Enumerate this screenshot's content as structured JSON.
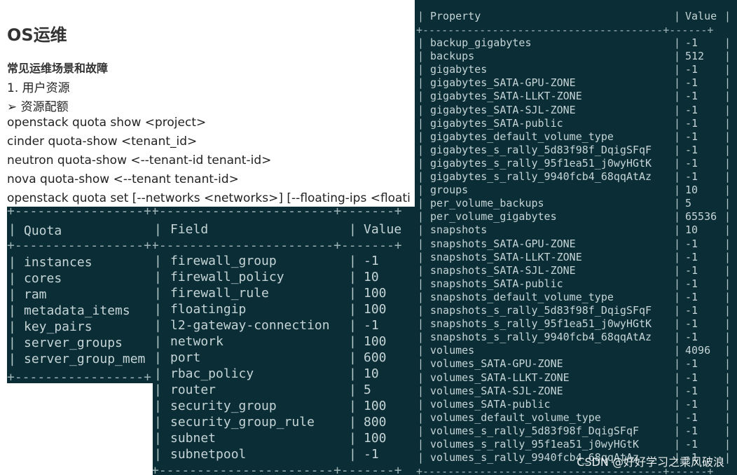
{
  "doc": {
    "title": "OS运维",
    "subtitle": "常见运维场景和故障",
    "lines": [
      "1.    用户资源",
      "➢   资源配额",
      "openstack quota show <project>",
      "cinder quota-show <tenant_id>",
      "neutron quota-show <--tenant-id tenant-id>",
      "nova quota-show <--tenant tenant-id>",
      "openstack quota set [--networks <networks>] [--floating-ips <floati"
    ]
  },
  "nova_table": {
    "header": "Quota",
    "rows": [
      "instances",
      "cores",
      "ram",
      "metadata_items",
      "key_pairs",
      "server_groups",
      "server_group_mem"
    ]
  },
  "neutron_table": {
    "header_field": "Field",
    "header_value": "Value",
    "rows": [
      {
        "field": "firewall_group",
        "value": "-1"
      },
      {
        "field": "firewall_policy",
        "value": "10"
      },
      {
        "field": "firewall_rule",
        "value": "100"
      },
      {
        "field": "floatingip",
        "value": "100"
      },
      {
        "field": "l2-gateway-connection",
        "value": "-1"
      },
      {
        "field": "network",
        "value": "100"
      },
      {
        "field": "port",
        "value": "600"
      },
      {
        "field": "rbac_policy",
        "value": "10"
      },
      {
        "field": "router",
        "value": "5"
      },
      {
        "field": "security_group",
        "value": "100"
      },
      {
        "field": "security_group_rule",
        "value": "800"
      },
      {
        "field": "subnet",
        "value": "100"
      },
      {
        "field": "subnetpool",
        "value": "-1"
      }
    ]
  },
  "cinder_table": {
    "header_property": "Property",
    "header_value": "Value",
    "rows": [
      {
        "property": "backup_gigabytes",
        "value": "-1"
      },
      {
        "property": "backups",
        "value": "512"
      },
      {
        "property": "gigabytes",
        "value": "-1"
      },
      {
        "property": "gigabytes_SATA-GPU-ZONE",
        "value": "-1"
      },
      {
        "property": "gigabytes_SATA-LLKT-ZONE",
        "value": "-1"
      },
      {
        "property": "gigabytes_SATA-SJL-ZONE",
        "value": "-1"
      },
      {
        "property": "gigabytes_SATA-public",
        "value": "-1"
      },
      {
        "property": "gigabytes_default_volume_type",
        "value": "-1"
      },
      {
        "property": "gigabytes_s_rally_5d83f98f_DqigSFqF",
        "value": "-1"
      },
      {
        "property": "gigabytes_s_rally_95f1ea51_j0wyHGtK",
        "value": "-1"
      },
      {
        "property": "gigabytes_s_rally_9940fcb4_68qqAtAz",
        "value": "-1"
      },
      {
        "property": "groups",
        "value": "10"
      },
      {
        "property": "per_volume_backups",
        "value": "5"
      },
      {
        "property": "per_volume_gigabytes",
        "value": "65536"
      },
      {
        "property": "snapshots",
        "value": "10"
      },
      {
        "property": "snapshots_SATA-GPU-ZONE",
        "value": "-1"
      },
      {
        "property": "snapshots_SATA-LLKT-ZONE",
        "value": "-1"
      },
      {
        "property": "snapshots_SATA-SJL-ZONE",
        "value": "-1"
      },
      {
        "property": "snapshots_SATA-public",
        "value": "-1"
      },
      {
        "property": "snapshots_default_volume_type",
        "value": "-1"
      },
      {
        "property": "snapshots_s_rally_5d83f98f_DqigSFqF",
        "value": "-1"
      },
      {
        "property": "snapshots_s_rally_95f1ea51_j0wyHGtK",
        "value": "-1"
      },
      {
        "property": "snapshots_s_rally_9940fcb4_68qqAtAz",
        "value": "-1"
      },
      {
        "property": "volumes",
        "value": "4096"
      },
      {
        "property": "volumes_SATA-GPU-ZONE",
        "value": "-1"
      },
      {
        "property": "volumes_SATA-LLKT-ZONE",
        "value": "-1"
      },
      {
        "property": "volumes_SATA-SJL-ZONE",
        "value": "-1"
      },
      {
        "property": "volumes_SATA-public",
        "value": "-1"
      },
      {
        "property": "volumes_default_volume_type",
        "value": "-1"
      },
      {
        "property": "volumes_s_rally_5d83f98f_DqigSFqF",
        "value": "-1"
      },
      {
        "property": "volumes_s_rally_95f1ea51_j0wyHGtK",
        "value": "-1"
      },
      {
        "property": "volumes_s_rally_9940fcb4_68qqAtAz",
        "value": "-1"
      }
    ]
  },
  "watermark": "CSDN @好好学习之乘风破浪",
  "colors": {
    "terminal_bg": "#0b2e36",
    "terminal_text": "#c5d4d6"
  }
}
